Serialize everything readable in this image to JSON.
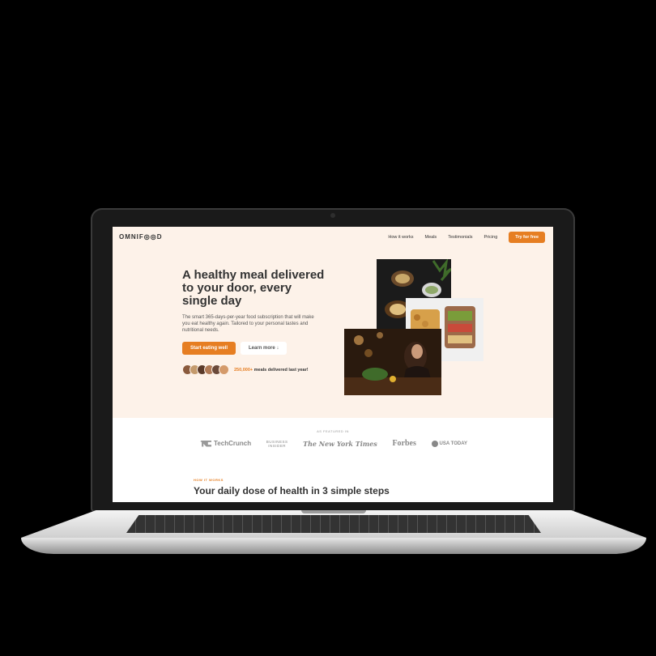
{
  "nav": {
    "logo": "OMNIF◎◎D",
    "links": [
      "How it works",
      "Meals",
      "Testimonials",
      "Pricing"
    ],
    "cta": "Try for free"
  },
  "hero": {
    "title": "A healthy meal delivered to your door, every single day",
    "description": "The smart 365-days-per-year food subscription that will make you eat healthy again. Tailored to your personal tastes and nutritional needs.",
    "primary_button": "Start eating well",
    "secondary_button": "Learn more ↓",
    "delivered_count": "250,000+",
    "delivered_text": " meals delivered last year!"
  },
  "featured": {
    "label": "AS FEATURED IN",
    "brands": {
      "techcrunch": "TechCrunch",
      "business_insider_1": "BUSINESS",
      "business_insider_2": "INSIDER",
      "nyt": "The New York Times",
      "forbes": "Forbes",
      "usa_today": "USA TODAY"
    }
  },
  "how": {
    "label": "HOW IT WORKS",
    "title": "Your daily dose of health in 3 simple steps"
  },
  "colors": {
    "accent": "#e67e22",
    "hero_bg": "#fdf2e9"
  }
}
